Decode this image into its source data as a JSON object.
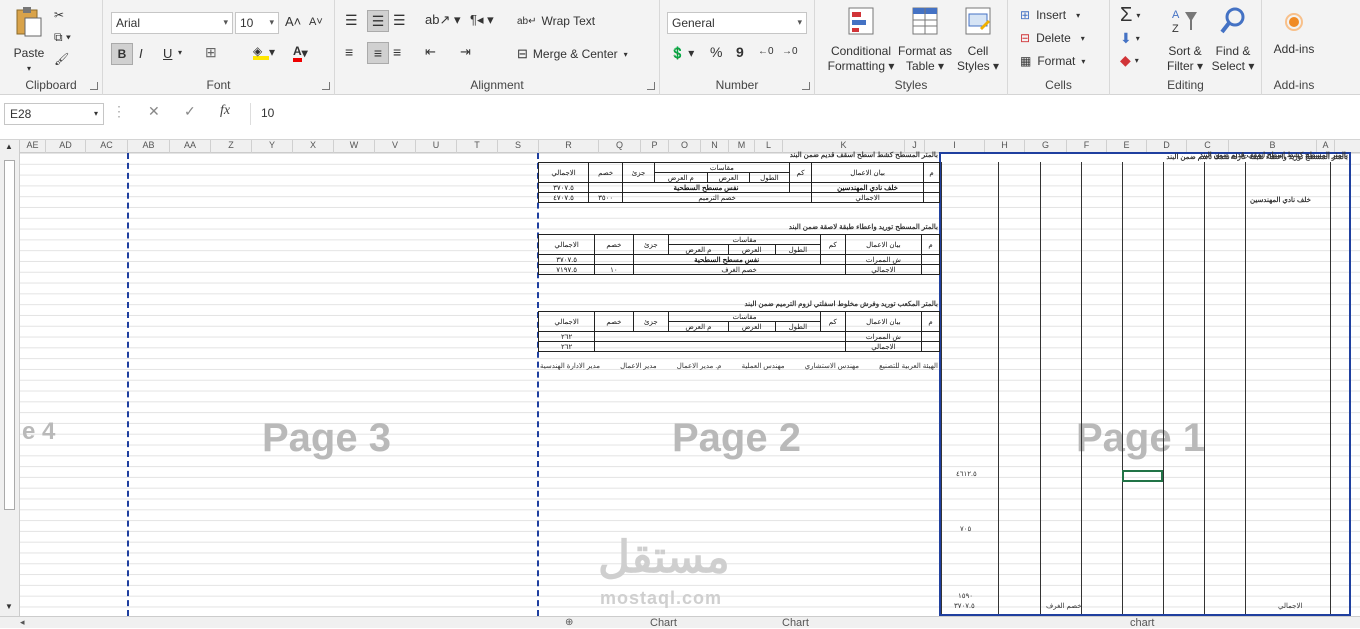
{
  "ribbon": {
    "clipboard": {
      "label": "Clipboard",
      "paste": "Paste"
    },
    "font": {
      "label": "Font",
      "family": "Arial",
      "size": "10",
      "bold": "B",
      "italic": "I",
      "underline": "U"
    },
    "alignment": {
      "label": "Alignment",
      "wrap_text": "Wrap Text",
      "merge_center": "Merge & Center"
    },
    "number": {
      "label": "Number",
      "format": "General",
      "percent": "%",
      "comma": "9"
    },
    "styles": {
      "label": "Styles",
      "conditional": "Conditional",
      "conditional2": "Formatting",
      "format_as": "Format as",
      "table": "Table",
      "cell": "Cell",
      "styles2": "Styles"
    },
    "cells": {
      "label": "Cells",
      "insert": "Insert",
      "delete": "Delete",
      "format": "Format"
    },
    "editing": {
      "label": "Editing",
      "sort": "Sort &",
      "filter": "Filter",
      "find": "Find &",
      "select": "Select"
    },
    "addins": {
      "label": "Add-ins",
      "btn": "Add-ins"
    }
  },
  "formula_bar": {
    "name_box": "E28",
    "value": "10",
    "fx": "fx"
  },
  "columns": [
    "AE",
    "AD",
    "AC",
    "AB",
    "AA",
    "Z",
    "Y",
    "X",
    "W",
    "V",
    "U",
    "T",
    "S",
    "R",
    "Q",
    "P",
    "O",
    "N",
    "M",
    "L",
    "K",
    "J",
    "I",
    "H",
    "G",
    "F",
    "E",
    "D",
    "C",
    "B",
    "A"
  ],
  "pages": {
    "p4": "e 4",
    "p3": "Page 3",
    "p2": "Page 2",
    "p1": "Page 1"
  },
  "page2": {
    "t1_title": "بالمتر المسطح كشط اسطح اسقف قديم ضمن البند",
    "t2_title": "بالمتر المسطح توريد واعطاء طبقة لاصقة ضمن البند",
    "t3_title": "بالمتر المكعب توريد وفرش مخلوط اسفلتي لزوم الترميم ضمن البند",
    "h_m": "م",
    "h_desc": "بيان الاعمال",
    "h_qty": "كم",
    "h_dims": "مقاسات",
    "h_len": "الطول",
    "h_wid": "العرض",
    "h_wid2": "م العرض",
    "h_part": "جزئ",
    "h_disc": "خصم",
    "h_total": "الاجمالي",
    "r_eng": "خلف نادي المهندسين",
    "r_same": "نفس مسطح السطحية",
    "r_total": "الاجمالي",
    "r_disc": "خصم الترميم",
    "r_disc2": "خصم الغرف",
    "r_corr": "ش الممرات",
    "v_3707": "٣٧٠٧.٥",
    "v_4707": "٤٧٠٧.٥",
    "v_3500": "٣٥٠٠",
    "v_7197": "٧١٩٧.٥",
    "v_10": "١٠",
    "v_262": "٢٦٢",
    "sig1": "الهيئة العربية للتصنيع",
    "sig2": "مهندس الاستشاري",
    "sig3": "مهندس العملية",
    "sig4": "م. مدير الاعمال",
    "sig5": "مدير الاعمال",
    "sig6": "مدير الادارة الهندسية"
  },
  "page1": {
    "title1": "بالمتر المسطح كشط اسطح اسقف قديم ضمن البند",
    "title2": "بالمتر المسطح توريد واعطاء طبقة عازلة سمك ٥سم ضمن البند",
    "row1": "خلف نادي المهندسين",
    "total_label": "الاجمالي",
    "disc_label": "خصم الغرف",
    "v_total": "٣٧٠٧.٥",
    "v_4612": "٤٦١٢.٥",
    "v_705": "٧٠٥",
    "v_1590": "١٥٩٠"
  },
  "tabs": [
    "Chart",
    "Chart",
    "chart"
  ],
  "watermark": {
    "ar": "مستقل",
    "en": "mostaql.com"
  }
}
